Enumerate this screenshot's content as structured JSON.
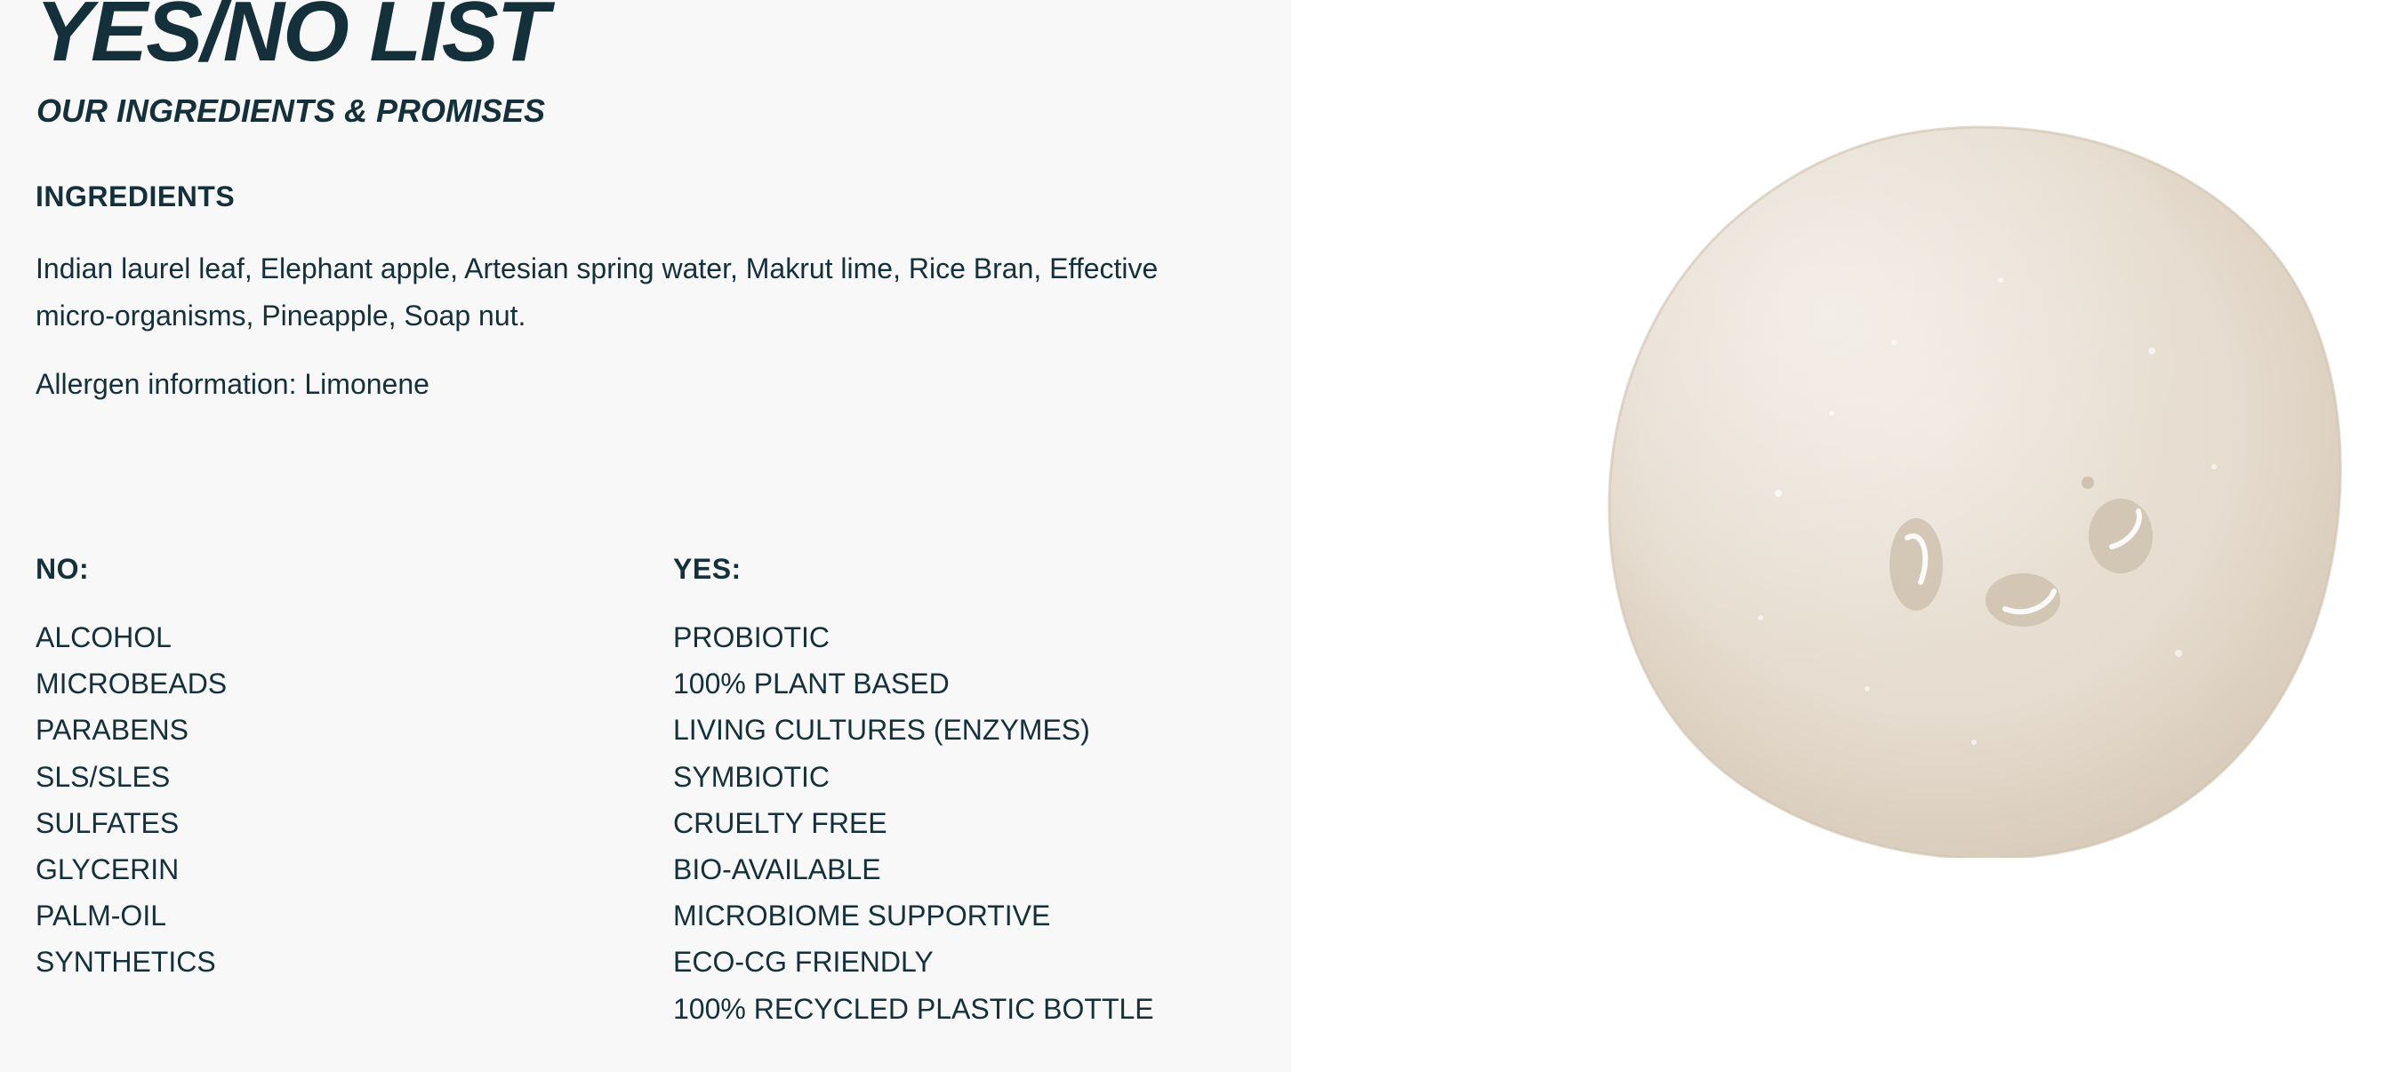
{
  "header": {
    "title": "YES/NO LIST",
    "subtitle": "OUR INGREDIENTS & PROMISES"
  },
  "ingredients": {
    "heading": "INGREDIENTS",
    "text": "Indian laurel leaf, Elephant apple, Artesian spring water, Makrut lime, Rice Bran, Effective micro-organisms, Pineapple, Soap nut.",
    "allergen": "Allergen information: Limonene"
  },
  "no_list": {
    "heading": "NO:",
    "items": [
      "ALCOHOL",
      "MICROBEADS",
      "PARABENS",
      "SLS/SLES",
      "SULFATES",
      "GLYCERIN",
      "PALM-OIL",
      "SYNTHETICS"
    ]
  },
  "yes_list": {
    "heading": "YES:",
    "items": [
      "PROBIOTIC",
      "100% PLANT BASED",
      "LIVING CULTURES (ENZYMES)",
      "SYMBIOTIC",
      "CRUELTY FREE",
      "BIO-AVAILABLE",
      "MICROBIOME SUPPORTIVE",
      "ECO-CG FRIENDLY",
      "100% RECYCLED PLASTIC BOTTLE"
    ]
  },
  "colors": {
    "text": "#14303a",
    "left_panel_bg": "#f8f8f8",
    "right_panel_bg": "#ffffff",
    "swatch": "#e7ddd0"
  }
}
